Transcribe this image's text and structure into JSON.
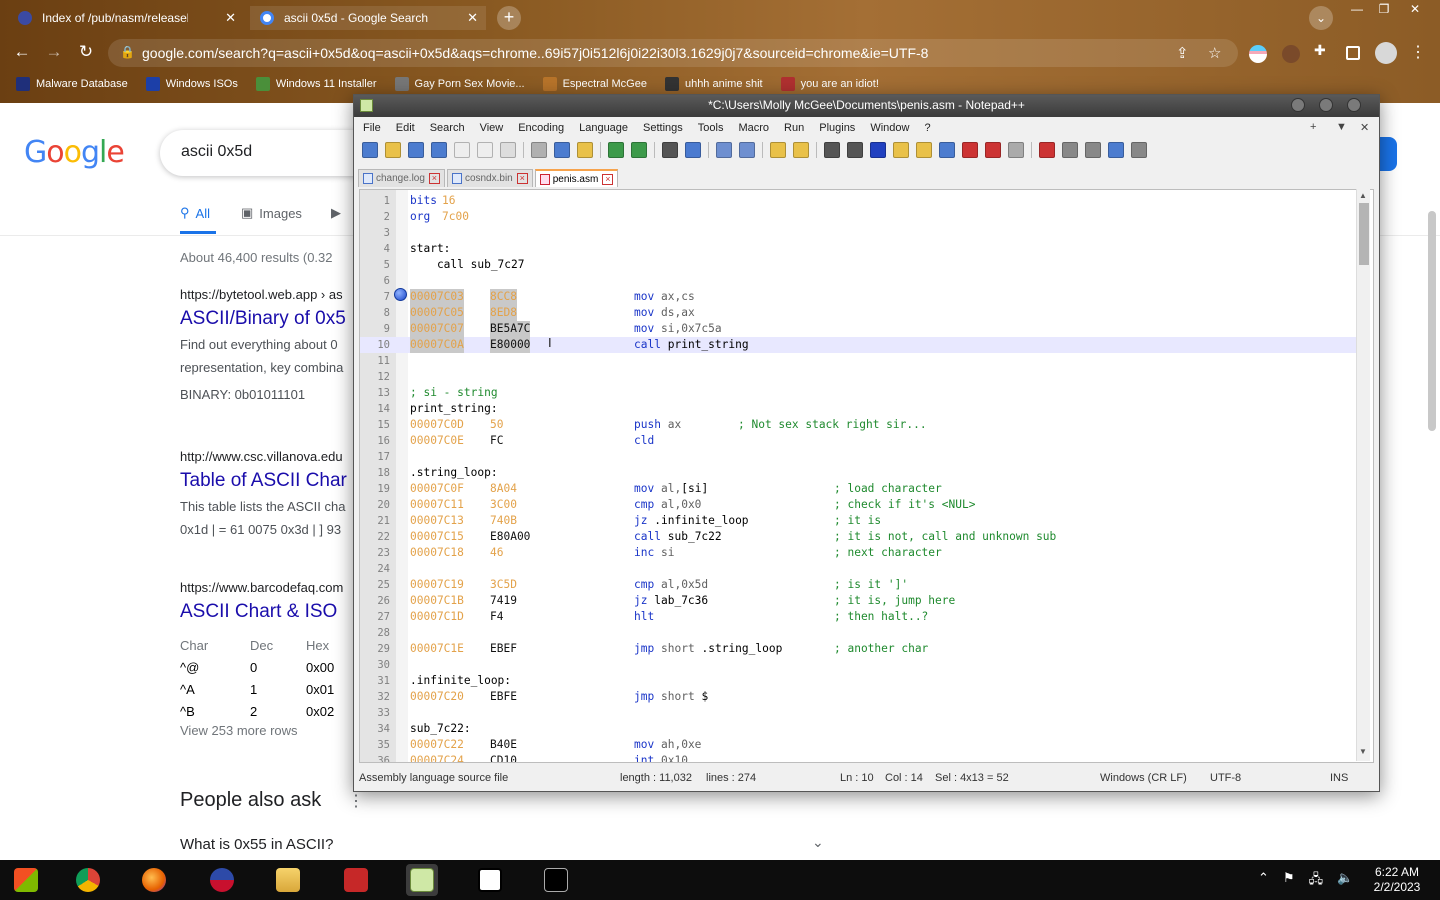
{
  "browser": {
    "tabs": [
      {
        "title": "Index of /pub/nasm/releasebuild",
        "close": "✕",
        "active": false
      },
      {
        "title": "ascii 0x5d - Google Search",
        "close": "✕",
        "active": true
      }
    ],
    "new_tab": "+",
    "tab_search": "⌄",
    "url": "google.com/search?q=ascii+0x5d&oq=ascii+0x5d&aqs=chrome..69i57j0i512l6j0i22i30l3.1629j0j7&sourceid=chrome&ie=UTF-8",
    "bookmarks": [
      {
        "label": "Malware Database",
        "color": "#1f2f7a"
      },
      {
        "label": "Windows ISOs",
        "color": "#1c3fa8"
      },
      {
        "label": "Windows 11 Installer",
        "color": "#4a8f3a"
      },
      {
        "label": "Gay Porn Sex Movie...",
        "color": "#777777"
      },
      {
        "label": "Espectral McGee",
        "color": "#b8742a"
      },
      {
        "label": "uhhh anime shit",
        "color": "#333333"
      },
      {
        "label": "you are an idiot!",
        "color": "#b03030"
      }
    ]
  },
  "google": {
    "query": "ascii 0x5d",
    "tabs": [
      {
        "label": "All",
        "icon": "search-icon"
      },
      {
        "label": "Images",
        "icon": "image-icon"
      }
    ],
    "stats": "About 46,400 results (0.32",
    "results": [
      {
        "cite": "https://bytetool.web.app › as",
        "title": "ASCII/Binary of 0x5",
        "snippets": [
          "Find out everything about 0",
          "representation, key combina",
          "BINARY: 0b01011101"
        ]
      },
      {
        "cite": "http://www.csc.villanova.edu",
        "title": "Table of ASCII Char",
        "snippets": [
          "This table lists the ASCII cha",
          "0x1d | = 61 0075 0x3d | ] 93"
        ]
      },
      {
        "cite": "https://www.barcodefaq.com",
        "title": "ASCII Chart & ISO",
        "snippets": []
      }
    ],
    "ascii_table": {
      "headers": [
        "Char",
        "Dec",
        "Hex"
      ],
      "rows": [
        [
          "^@",
          "0",
          "0x00"
        ],
        [
          "^A",
          "1",
          "0x01"
        ],
        [
          "^B",
          "2",
          "0x02"
        ]
      ],
      "more": "View 253 more rows"
    },
    "paa_title": "People also ask",
    "paa_question": "What is 0x55 in ASCII?"
  },
  "notepad": {
    "title": "*C:\\Users\\Molly McGee\\Documents\\penis.asm - Notepad++",
    "menu": [
      "File",
      "Edit",
      "Search",
      "View",
      "Encoding",
      "Language",
      "Settings",
      "Tools",
      "Macro",
      "Run",
      "Plugins",
      "Window",
      "?"
    ],
    "menu_right": [
      "+",
      "▼",
      "✕"
    ],
    "tabs": [
      {
        "label": "change.log",
        "active": false
      },
      {
        "label": "cosndx.bin",
        "active": false
      },
      {
        "label": "penis.asm",
        "active": true
      }
    ],
    "lines": [
      {
        "n": "1",
        "label": "",
        "ldir": "bits",
        "larg": "16"
      },
      {
        "n": "2",
        "ldir": "org",
        "larg": "7c00"
      },
      {
        "n": "3"
      },
      {
        "n": "4",
        "label": "start:"
      },
      {
        "n": "5",
        "label": "    call sub_7c27"
      },
      {
        "n": "6"
      },
      {
        "n": "7",
        "addr": "00007C03",
        "hex": "8CC8",
        "sel": true,
        "hexorg": true,
        "mn": "mov",
        "ops": "ax,cs"
      },
      {
        "n": "8",
        "addr": "00007C05",
        "hex": "8ED8",
        "sel": true,
        "hexorg": true,
        "mn": "mov",
        "ops": "ds,ax"
      },
      {
        "n": "9",
        "addr": "00007C07",
        "hex": "BE5A7C",
        "sel": true,
        "mn": "mov",
        "ops": "si,0x7c5a"
      },
      {
        "n": "10",
        "addr": "00007C0A",
        "hex": "E80000",
        "sel": true,
        "mn": "call",
        "lbl2": "print_string",
        "cur": true
      },
      {
        "n": "11"
      },
      {
        "n": "12"
      },
      {
        "n": "13",
        "cmtfull": "; si - string"
      },
      {
        "n": "14",
        "label": "print_string:"
      },
      {
        "n": "15",
        "addr": "00007C0D",
        "hex": "50",
        "hexorg": true,
        "mn": "push",
        "ops": "ax",
        "cmt": "; Not sex stack right sir...",
        "cmtx": 728
      },
      {
        "n": "16",
        "addr": "00007C0E",
        "hex": "FC",
        "mn": "cld"
      },
      {
        "n": "17"
      },
      {
        "n": "18",
        "label": ".string_loop:"
      },
      {
        "n": "19",
        "addr": "00007C0F",
        "hex": "8A04",
        "hexorg": true,
        "mn": "mov",
        "ops": "al,",
        "lbl2": "[si]",
        "cmt": "; load character",
        "cmtx": 824
      },
      {
        "n": "20",
        "addr": "00007C11",
        "hex": "3C00",
        "hexorg": true,
        "mn": "cmp",
        "ops": "al,0x0",
        "cmt": "; check if it's <NUL>",
        "cmtx": 824
      },
      {
        "n": "21",
        "addr": "00007C13",
        "hex": "740B",
        "hexorg": true,
        "mn": "jz",
        "lbl2": ".infinite_loop",
        "cmt": "; it is",
        "cmtx": 824
      },
      {
        "n": "22",
        "addr": "00007C15",
        "hex": "E80A00",
        "mn": "call",
        "lbl2": "sub_7c22",
        "cmt": "; it is not, call and unknown sub",
        "cmtx": 824
      },
      {
        "n": "23",
        "addr": "00007C18",
        "hex": "46",
        "hexorg": true,
        "mn": "inc",
        "ops": "si",
        "cmt": "; next character",
        "cmtx": 824
      },
      {
        "n": "24"
      },
      {
        "n": "25",
        "addr": "00007C19",
        "hex": "3C5D",
        "hexorg": true,
        "mn": "cmp",
        "ops": "al,0x5d",
        "cmt": "; is it ']'",
        "cmtx": 824
      },
      {
        "n": "26",
        "addr": "00007C1B",
        "hex": "7419",
        "mn": "jz",
        "lbl2": "lab_7c36",
        "cmt": "; it is, jump here",
        "cmtx": 824
      },
      {
        "n": "27",
        "addr": "00007C1D",
        "hex": "F4",
        "mn": "hlt",
        "cmt": "; then halt..?",
        "cmtx": 824
      },
      {
        "n": "28"
      },
      {
        "n": "29",
        "addr": "00007C1E",
        "hex": "EBEF",
        "mn": "jmp",
        "ops": "short",
        "lbl2": ".string_loop",
        "cmt": "; another char",
        "cmtx": 824
      },
      {
        "n": "30"
      },
      {
        "n": "31",
        "label": ".infinite_loop:"
      },
      {
        "n": "32",
        "addr": "00007C20",
        "hex": "EBFE",
        "mn": "jmp",
        "ops": "short",
        "lbl2": "$"
      },
      {
        "n": "33"
      },
      {
        "n": "34",
        "label": "sub_7c22:"
      },
      {
        "n": "35",
        "addr": "00007C22",
        "hex": "B40E",
        "mn": "mov",
        "ops": "ah,0xe"
      },
      {
        "n": "36",
        "addr": "00007C24",
        "hex": "CD10",
        "mn": "int",
        "ops": "0x10"
      }
    ],
    "status": {
      "type": "Assembly language source file",
      "length": "length : 11,032",
      "lines": "lines : 274",
      "ln": "Ln : 10",
      "col": "Col : 14",
      "sel": "Sel : 4x13 = 52",
      "eol": "Windows (CR LF)",
      "enc": "UTF-8",
      "mode": "INS"
    }
  },
  "taskbar": {
    "apps": [
      "windows-start",
      "chrome",
      "firefox",
      "opera",
      "file-explorer",
      "dev-cpp",
      "notepad-plus-plus",
      "7zip",
      "command-prompt"
    ],
    "time": "6:22 AM",
    "date": "2/2/2023"
  }
}
